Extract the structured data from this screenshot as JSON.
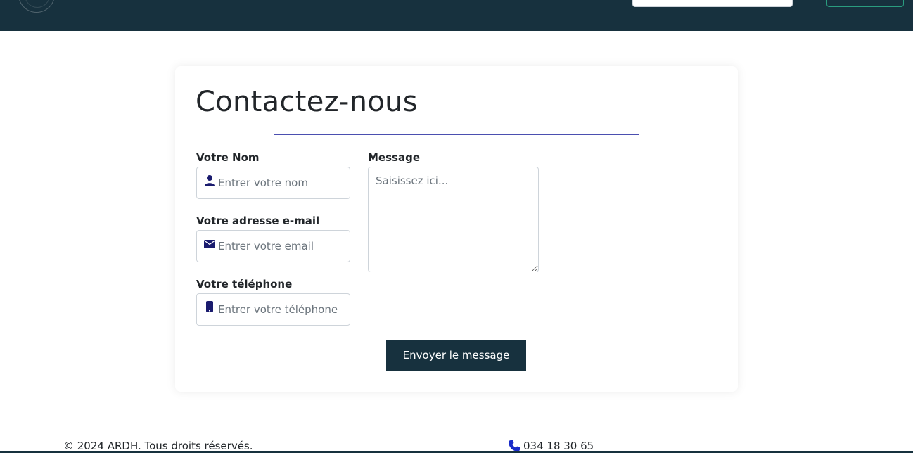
{
  "header": {
    "search_placeholder": "",
    "button_label": ""
  },
  "contact": {
    "title": "Contactez-nous",
    "name_label": "Votre Nom",
    "name_placeholder": "Entrer votre nom",
    "email_label": "Votre adresse e-mail",
    "email_placeholder": "Entrer votre email",
    "phone_label": "Votre téléphone",
    "phone_placeholder": "Entrer votre téléphone",
    "message_label": "Message",
    "message_placeholder": "Saisissez ici...",
    "submit_label": "Envoyer le message"
  },
  "footer": {
    "copyright": "© 2024 ARDH. Tous droits réservés.",
    "phone": "034 18 30 65"
  },
  "icons": {
    "name": "user-icon",
    "email": "envelope-icon",
    "phone": "mobile-icon",
    "footer_phone": "phone-icon"
  },
  "colors": {
    "header_bg": "#17313e",
    "accent": "#1a1b6e",
    "divider": "#4b4fb0",
    "button_bg": "#17313e",
    "phone_icon": "#1a2cc9"
  }
}
